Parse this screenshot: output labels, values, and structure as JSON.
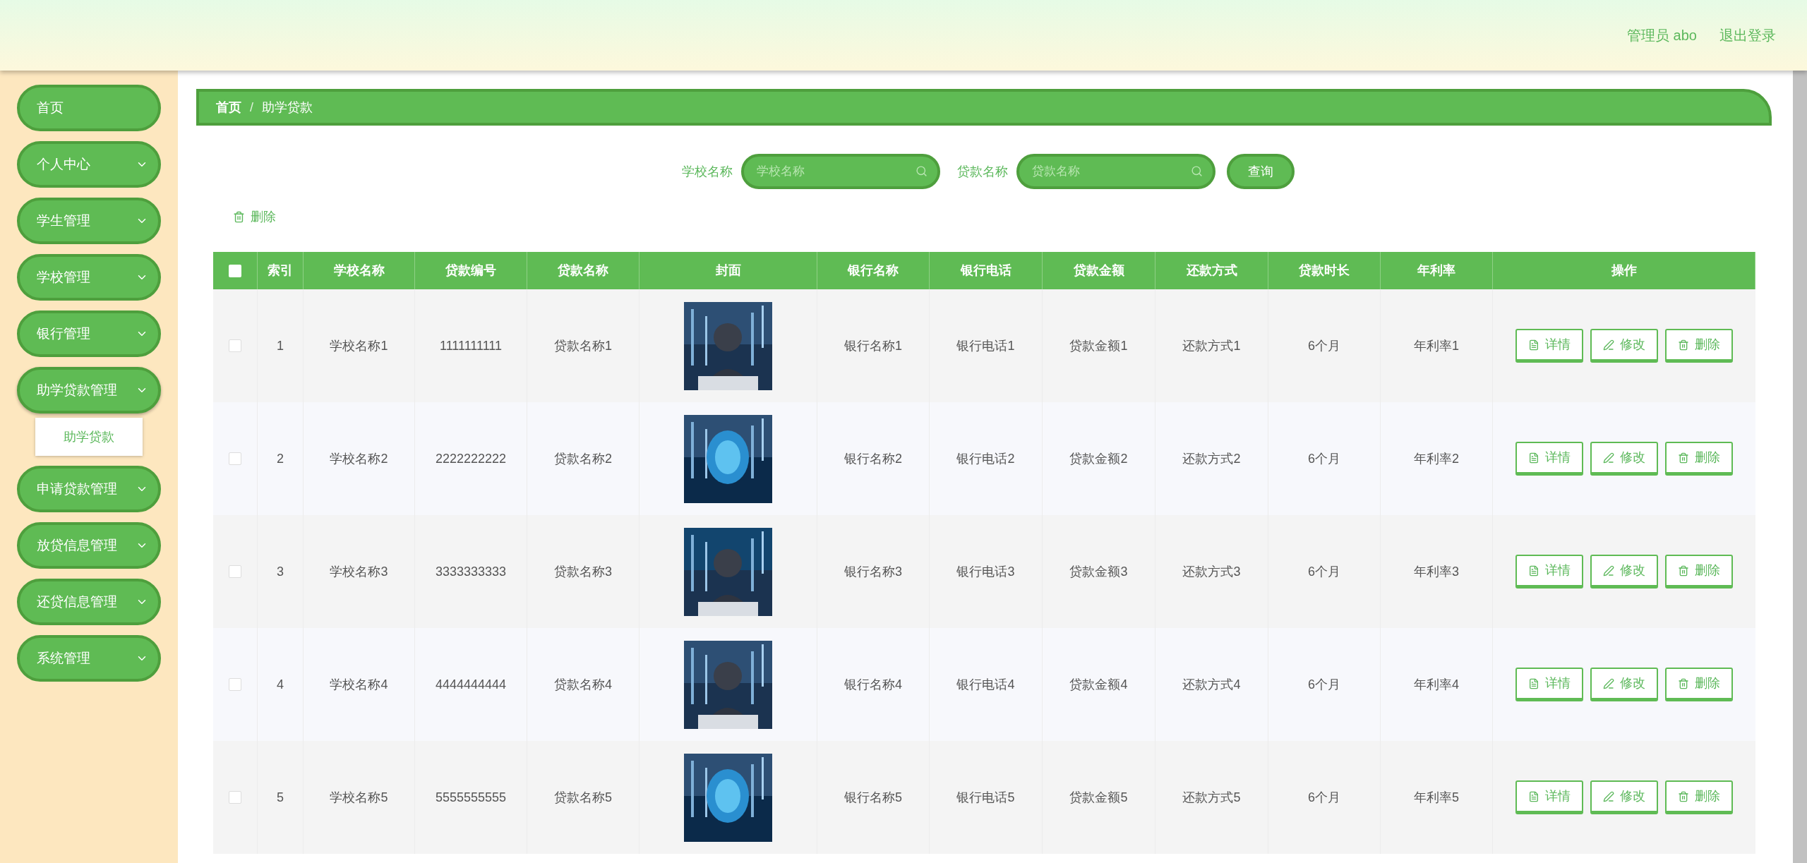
{
  "header": {
    "user_label": "管理员 abo",
    "logout": "退出登录"
  },
  "sidebar": {
    "items": [
      {
        "label": "首页",
        "kind": "link",
        "expanded": false
      },
      {
        "label": "个人中心",
        "kind": "group",
        "expanded": false
      },
      {
        "label": "学生管理",
        "kind": "group",
        "expanded": false
      },
      {
        "label": "学校管理",
        "kind": "group",
        "expanded": false
      },
      {
        "label": "银行管理",
        "kind": "group",
        "expanded": false
      },
      {
        "label": "助学贷款管理",
        "kind": "group",
        "expanded": true,
        "children": [
          {
            "label": "助学贷款"
          }
        ]
      },
      {
        "label": "申请贷款管理",
        "kind": "group",
        "expanded": false
      },
      {
        "label": "放贷信息管理",
        "kind": "group",
        "expanded": false
      },
      {
        "label": "还贷信息管理",
        "kind": "group",
        "expanded": false
      },
      {
        "label": "系统管理",
        "kind": "group",
        "expanded": false
      }
    ]
  },
  "breadcrumb": {
    "items": [
      "首页",
      "助学贷款"
    ],
    "separator": "/"
  },
  "search": {
    "fields": [
      {
        "label": "学校名称",
        "placeholder": "学校名称"
      },
      {
        "label": "贷款名称",
        "placeholder": "贷款名称"
      }
    ],
    "button": "查询"
  },
  "bulk_delete": "删除",
  "table": {
    "columns": [
      "索引",
      "学校名称",
      "贷款编号",
      "贷款名称",
      "封面",
      "银行名称",
      "银行电话",
      "贷款金额",
      "还款方式",
      "贷款时长",
      "年利率",
      "操作"
    ],
    "header_checked": false,
    "rows": [
      {
        "checked": false,
        "cells": [
          "1",
          "学校名称1",
          "1111111111",
          "贷款名称1",
          {
            "kind": "picture"
          },
          "银行名称1",
          "银行电话1",
          "贷款金额1",
          "还款方式1",
          "6个月",
          "年利率1"
        ],
        "actions": [
          {
            "kind": "detail",
            "label": "详情"
          },
          {
            "kind": "edit",
            "label": "修改"
          },
          {
            "kind": "delete",
            "label": "删除"
          }
        ]
      },
      {
        "checked": false,
        "cells": [
          "2",
          "学校名称2",
          "2222222222",
          "贷款名称2",
          {
            "kind": "picture"
          },
          "银行名称2",
          "银行电话2",
          "贷款金额2",
          "还款方式2",
          "6个月",
          "年利率2"
        ],
        "actions": [
          {
            "kind": "detail",
            "label": "详情"
          },
          {
            "kind": "edit",
            "label": "修改"
          },
          {
            "kind": "delete",
            "label": "删除"
          }
        ]
      },
      {
        "checked": false,
        "cells": [
          "3",
          "学校名称3",
          "3333333333",
          "贷款名称3",
          {
            "kind": "picture"
          },
          "银行名称3",
          "银行电话3",
          "贷款金额3",
          "还款方式3",
          "6个月",
          "年利率3"
        ],
        "actions": [
          {
            "kind": "detail",
            "label": "详情"
          },
          {
            "kind": "edit",
            "label": "修改"
          },
          {
            "kind": "delete",
            "label": "删除"
          }
        ]
      },
      {
        "checked": false,
        "cells": [
          "4",
          "学校名称4",
          "4444444444",
          "贷款名称4",
          {
            "kind": "picture"
          },
          "银行名称4",
          "银行电话4",
          "贷款金额4",
          "还款方式4",
          "6个月",
          "年利率4"
        ],
        "actions": [
          {
            "kind": "detail",
            "label": "详情"
          },
          {
            "kind": "edit",
            "label": "修改"
          },
          {
            "kind": "delete",
            "label": "删除"
          }
        ]
      },
      {
        "checked": false,
        "cells": [
          "5",
          "学校名称5",
          "5555555555",
          "贷款名称5",
          {
            "kind": "picture"
          },
          "银行名称5",
          "银行电话5",
          "贷款金额5",
          "还款方式5",
          "6个月",
          "年利率5"
        ],
        "actions": [
          {
            "kind": "detail",
            "label": "详情"
          },
          {
            "kind": "edit",
            "label": "修改"
          },
          {
            "kind": "delete",
            "label": "删除"
          }
        ]
      }
    ]
  }
}
